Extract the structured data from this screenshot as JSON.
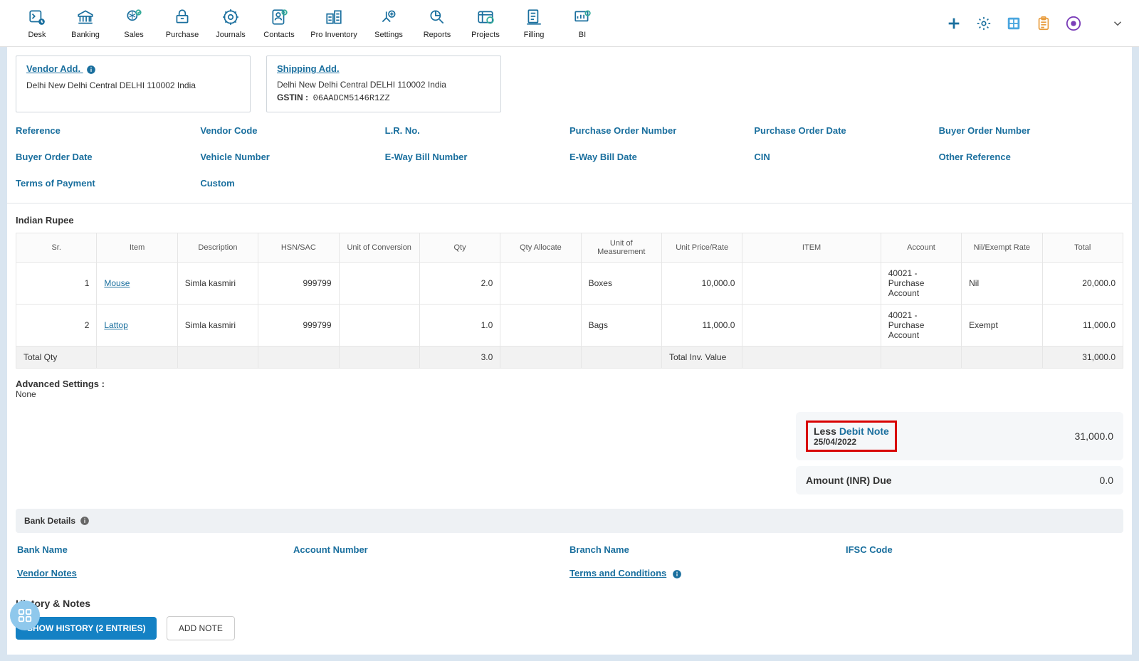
{
  "nav": [
    {
      "label": "Desk"
    },
    {
      "label": "Banking"
    },
    {
      "label": "Sales"
    },
    {
      "label": "Purchase"
    },
    {
      "label": "Journals"
    },
    {
      "label": "Contacts"
    },
    {
      "label": "Pro Inventory"
    },
    {
      "label": "Settings"
    },
    {
      "label": "Reports"
    },
    {
      "label": "Projects"
    },
    {
      "label": "Filling"
    },
    {
      "label": "BI"
    }
  ],
  "vendor": {
    "title": "Vendor Add.",
    "line": "Delhi New Delhi Central DELHI 110002 India"
  },
  "shipping": {
    "title": "Shipping Add.",
    "line": "Delhi New Delhi Central DELHI 110002 India",
    "gstin_label": "GSTIN :",
    "gstin": "06AADCM5146R1ZZ"
  },
  "infoFields": [
    "Reference",
    "Vendor Code",
    "L.R. No.",
    "Purchase Order Number",
    "Purchase Order Date",
    "Buyer Order Number",
    "Buyer Order Date",
    "Vehicle Number",
    "E-Way Bill Number",
    "E-Way Bill Date",
    "CIN",
    "Other Reference",
    "Terms of Payment",
    "Custom"
  ],
  "currency": "Indian Rupee",
  "cols": [
    "Sr.",
    "Item",
    "Description",
    "HSN/SAC",
    "Unit of Conversion",
    "Qty",
    "Qty Allocate",
    "Unit of Measurement",
    "Unit Price/Rate",
    "ITEM",
    "Account",
    "Nil/Exempt Rate",
    "Total"
  ],
  "rows": [
    {
      "sr": "1",
      "item": "Mouse",
      "desc": "Simla kasmiri",
      "hsn": "999799",
      "uoc": "",
      "qty": "2.0",
      "qalloc": "",
      "uom": "Boxes",
      "rate": "10,000.0",
      "itemcol": "",
      "acct": "40021 - Purchase Account",
      "nil": "Nil",
      "total": "20,000.0"
    },
    {
      "sr": "2",
      "item": "Lattop",
      "desc": "Simla kasmiri",
      "hsn": "999799",
      "uoc": "",
      "qty": "1.0",
      "qalloc": "",
      "uom": "Bags",
      "rate": "11,000.0",
      "itemcol": "",
      "acct": "40021 - Purchase Account",
      "nil": "Exempt",
      "total": "11,000.0"
    }
  ],
  "totals": {
    "qtyLabel": "Total Qty",
    "qty": "3.0",
    "invLabel": "Total Inv. Value",
    "inv": "31,000.0"
  },
  "advanced": {
    "title": "Advanced Settings :",
    "value": "None"
  },
  "summary": {
    "lessPrefix": "Less ",
    "lessLink": "Debit Note",
    "lessDate": "25/04/2022",
    "lessValue": "31,000.0",
    "dueLabel": "Amount (INR) Due",
    "dueValue": "0.0"
  },
  "bank": {
    "title": "Bank Details",
    "bankName": "Bank Name",
    "acct": "Account Number",
    "branch": "Branch Name",
    "ifsc": "IFSC Code"
  },
  "vendorNotes": "Vendor Notes",
  "terms": "Terms and Conditions",
  "history": {
    "title": "History & Notes",
    "show": "SHOW HISTORY (2 ENTRIES)",
    "add": "ADD NOTE"
  }
}
